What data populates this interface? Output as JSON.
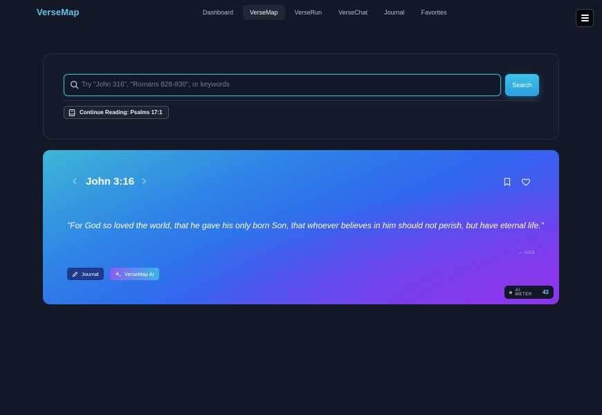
{
  "app": {
    "brand": "VerseMap"
  },
  "nav": {
    "items": [
      {
        "label": "Dashboard",
        "active": false
      },
      {
        "label": "VerseMap",
        "active": true
      },
      {
        "label": "VerseRun",
        "active": false
      },
      {
        "label": "VerseChat",
        "active": false
      },
      {
        "label": "Journal",
        "active": false
      },
      {
        "label": "Favorites",
        "active": false
      }
    ],
    "menu_icon": "hamburger-icon"
  },
  "search": {
    "placeholder": "Try \"John 316\", \"Romans 828-830\", or keywords",
    "value": "",
    "button_label": "Search",
    "icon": "search-icon",
    "continue_label": "Continue Reading: Psalms 17:1",
    "continue_icon": "book-icon"
  },
  "verse": {
    "reference": "John 3:16",
    "text": "\"For God so loved the world, that he gave his only born Son, that whoever believes in him should not perish, but have eternal life.\"",
    "translation": "— WEB",
    "actions": {
      "bookmark_icon": "bookmark-icon",
      "favorite_icon": "heart-icon",
      "prev_icon": "chevron-left-icon",
      "next_icon": "chevron-right-icon"
    },
    "journal_label": "Journal",
    "ai_label": "VerseMap AI",
    "meter_label": "AI METER",
    "meter_value": "43"
  },
  "colors": {
    "background": "#121826",
    "brand": "#5fc4e8",
    "accent": "#3bb5d6",
    "card_gradient_start": "#3cb7d6",
    "card_gradient_end": "#8a39ea"
  }
}
